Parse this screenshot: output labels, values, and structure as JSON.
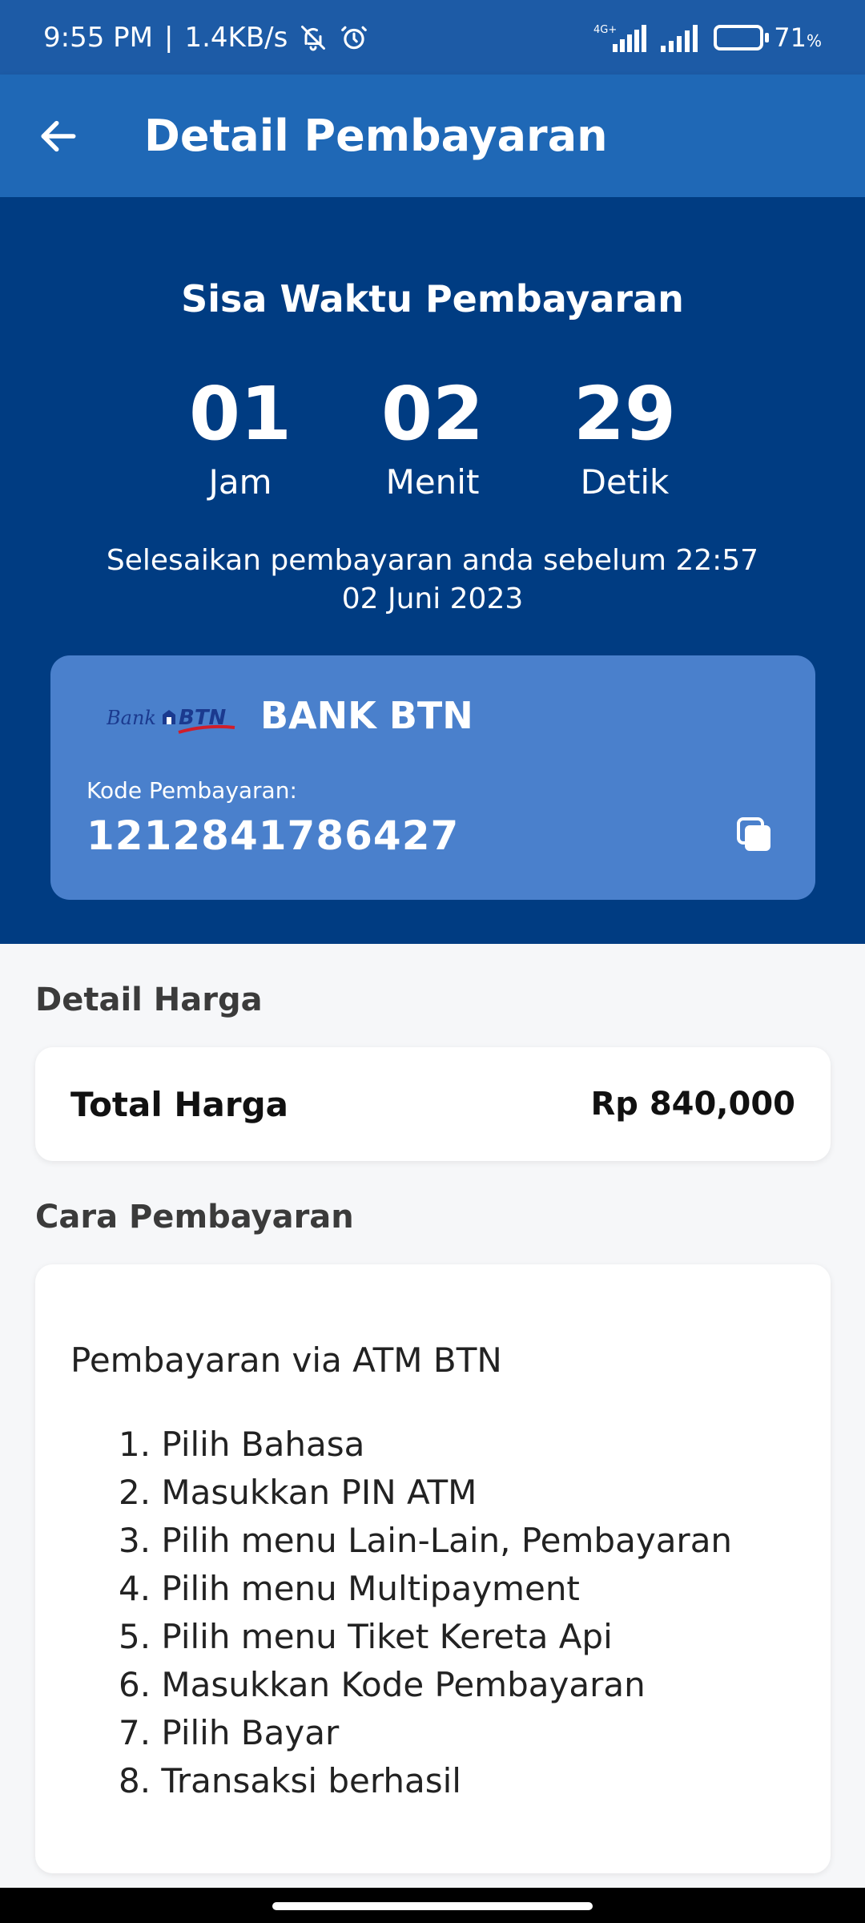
{
  "status_bar": {
    "time": "9:55 PM",
    "separator": "|",
    "speed": "1.4KB/s",
    "network_label": "4G+",
    "battery_percent": "71",
    "battery_unit": "%",
    "battery_level": 0.71
  },
  "app_bar": {
    "title": "Detail Pembayaran"
  },
  "timer": {
    "title": "Sisa Waktu Pembayaran",
    "hours": "01",
    "hours_label": "Jam",
    "minutes": "02",
    "minutes_label": "Menit",
    "seconds": "29",
    "seconds_label": "Detik",
    "note_line1": "Selesaikan pembayaran anda sebelum 22:57",
    "note_line2": "02 Juni 2023"
  },
  "bank_card": {
    "logo_text_bank": "Bank",
    "logo_text_btn": "BTN",
    "bank_name": "BANK BTN",
    "code_label": "Kode Pembayaran:",
    "code_value": "1212841786427"
  },
  "price": {
    "section_title": "Detail Harga",
    "label": "Total Harga",
    "value": "Rp 840,000"
  },
  "method": {
    "section_title": "Cara Pembayaran",
    "title": "Pembayaran via ATM BTN",
    "steps": [
      "1. Pilih Bahasa",
      "2. Masukkan PIN ATM",
      "3. Pilih menu Lain-Lain, Pembayaran",
      "4. Pilih menu Multipayment",
      "5. Pilih menu Tiket Kereta Api",
      "6. Masukkan Kode Pembayaran",
      "7. Pilih Bayar",
      "8. Transaksi berhasil"
    ]
  },
  "colors": {
    "status_bar": "#1d5ba6",
    "app_bar": "#1f68b6",
    "timer_bg": "#003c82",
    "card_bg": "#4a80cc",
    "page_bg": "#f6f7f9"
  }
}
